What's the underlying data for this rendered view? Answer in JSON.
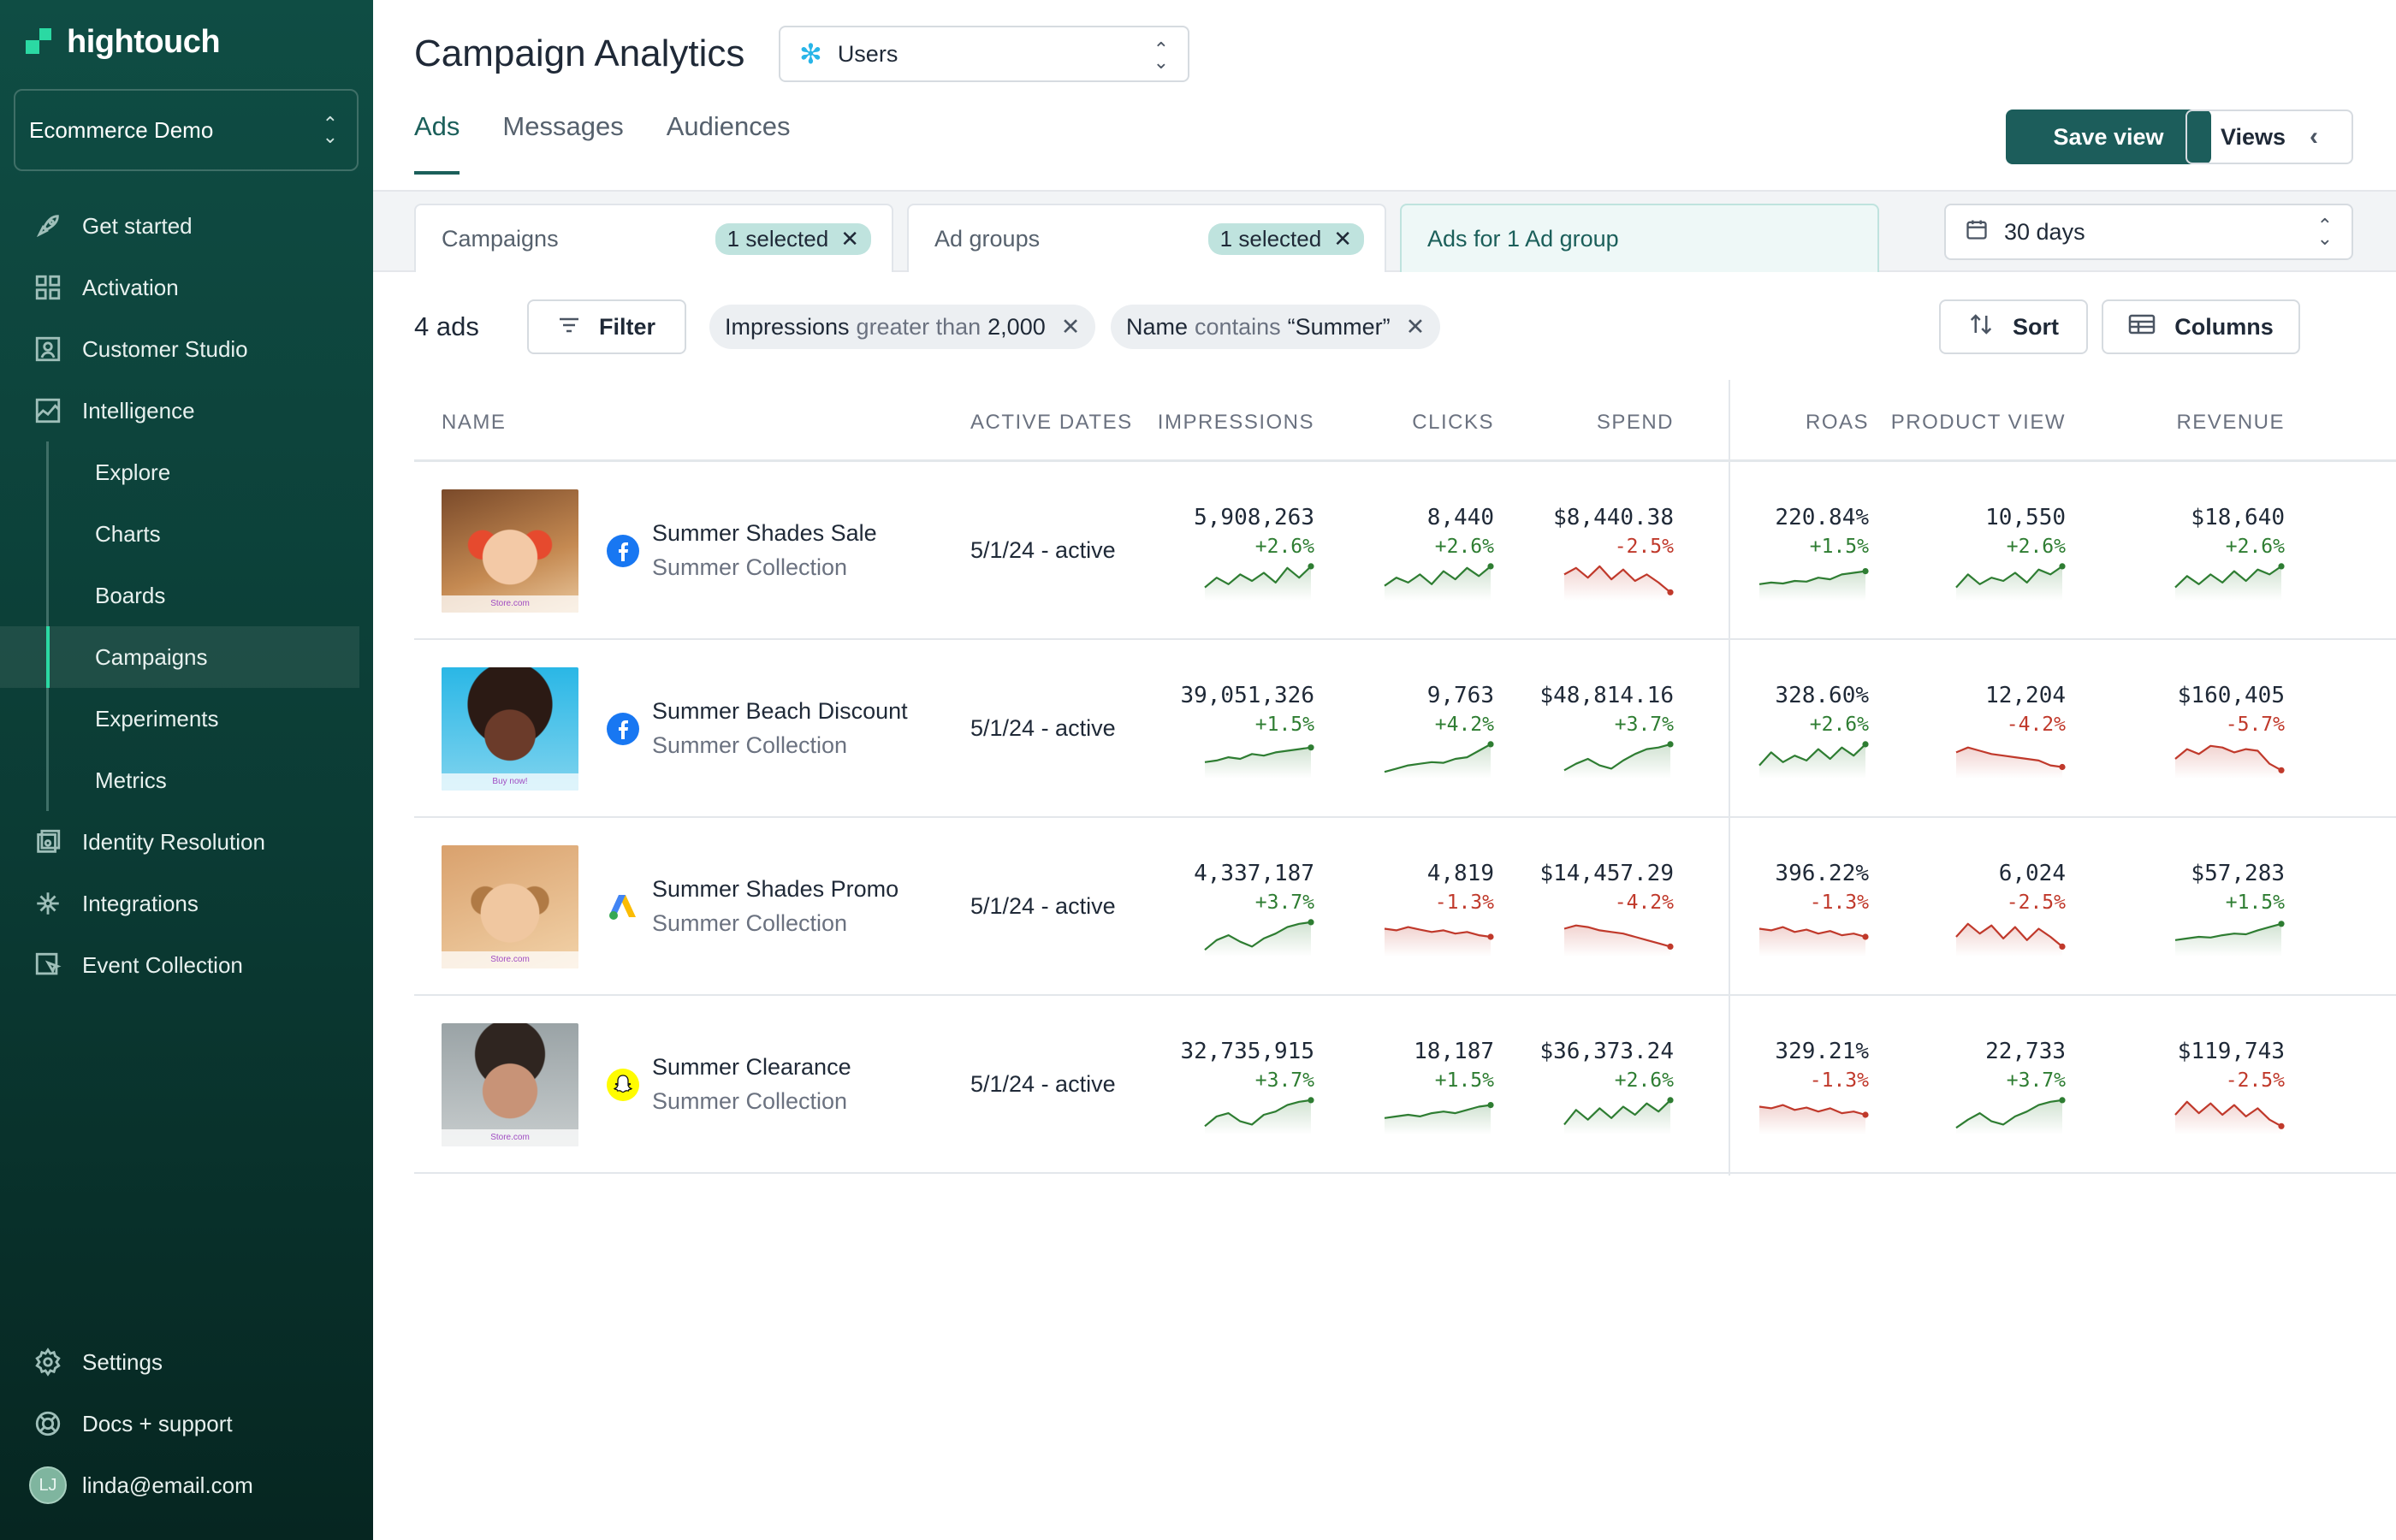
{
  "app": {
    "logo_text": "hightouch",
    "workspace": "Ecommerce Demo"
  },
  "sidebar": {
    "items": [
      {
        "label": "Get started",
        "icon": "rocket-icon"
      },
      {
        "label": "Activation",
        "icon": "grid-icon"
      },
      {
        "label": "Customer Studio",
        "icon": "person-box-icon"
      },
      {
        "label": "Intelligence",
        "icon": "chart-area-icon"
      }
    ],
    "sub_items": [
      "Explore",
      "Charts",
      "Boards",
      "Campaigns",
      "Experiments",
      "Metrics"
    ],
    "active_sub": "Campaigns",
    "items2": [
      {
        "label": "Identity Resolution",
        "icon": "identity-icon"
      },
      {
        "label": "Integrations",
        "icon": "integrations-icon"
      },
      {
        "label": "Event Collection",
        "icon": "event-icon"
      }
    ],
    "bottom": [
      {
        "label": "Settings",
        "icon": "gear-icon"
      },
      {
        "label": "Docs + support",
        "icon": "lifebuoy-icon"
      }
    ],
    "user": {
      "initials": "LJ",
      "email": "linda@email.com"
    }
  },
  "header": {
    "title": "Campaign Analytics",
    "source": "Users",
    "tabs": [
      "Ads",
      "Messages",
      "Audiences"
    ],
    "active_tab": "Ads",
    "save_view": "Save view",
    "views": "Views"
  },
  "filters": {
    "campaigns": {
      "label": "Campaigns",
      "chip": "1 selected"
    },
    "ad_groups": {
      "label": "Ad groups",
      "chip": "1 selected"
    },
    "ads": {
      "label": "Ads for 1 Ad group"
    },
    "date_range": "30 days"
  },
  "toolbar": {
    "count": "4 ads",
    "filter": "Filter",
    "pills": [
      {
        "field": "Impressions",
        "op": "greater than",
        "value": "2,000"
      },
      {
        "field": "Name",
        "op": "contains",
        "value": "“Summer”"
      }
    ],
    "sort": "Sort",
    "columns": "Columns"
  },
  "table": {
    "columns": [
      "NAME",
      "ACTIVE DATES",
      "IMPRESSIONS",
      "CLICKS",
      "SPEND",
      "ROAS",
      "PRODUCT VIEW",
      "REVENUE"
    ],
    "rows": [
      {
        "name": "Summer Shades Sale",
        "collection": "Summer Collection",
        "platform": "facebook-icon",
        "thumb_caption": "Store.com",
        "dates": "5/1/24 - active",
        "metrics": [
          {
            "value": "5,908,263",
            "delta": "+2.6%",
            "dir": "up",
            "spark": [
              0.3,
              0.6,
              0.4,
              0.7,
              0.5,
              0.75,
              0.45,
              0.9,
              0.6,
              0.95
            ]
          },
          {
            "value": "8,440",
            "delta": "+2.6%",
            "dir": "up",
            "spark": [
              0.35,
              0.6,
              0.45,
              0.7,
              0.4,
              0.8,
              0.55,
              0.9,
              0.65,
              0.95
            ]
          },
          {
            "value": "$8,440.38",
            "delta": "-2.5%",
            "dir": "down",
            "spark": [
              0.7,
              0.9,
              0.6,
              0.95,
              0.55,
              0.85,
              0.5,
              0.7,
              0.45,
              0.15
            ]
          },
          {
            "value": "220.84%",
            "delta": "+1.5%",
            "dir": "up",
            "spark": [
              0.4,
              0.45,
              0.42,
              0.5,
              0.48,
              0.6,
              0.55,
              0.7,
              0.75,
              0.8
            ]
          },
          {
            "value": "10,550",
            "delta": "+2.6%",
            "dir": "up",
            "spark": [
              0.3,
              0.7,
              0.4,
              0.6,
              0.5,
              0.75,
              0.45,
              0.85,
              0.7,
              0.95
            ]
          },
          {
            "value": "$18,640",
            "delta": "+2.6%",
            "dir": "up",
            "spark": [
              0.3,
              0.65,
              0.4,
              0.7,
              0.45,
              0.8,
              0.5,
              0.85,
              0.7,
              0.95
            ]
          }
        ]
      },
      {
        "name": "Summer Beach Discount",
        "collection": "Summer Collection",
        "platform": "facebook-icon",
        "thumb_caption": "Buy now!",
        "dates": "5/1/24 - active",
        "metrics": [
          {
            "value": "39,051,326",
            "delta": "+1.5%",
            "dir": "up",
            "spark": [
              0.4,
              0.45,
              0.55,
              0.5,
              0.65,
              0.6,
              0.7,
              0.75,
              0.8,
              0.85
            ]
          },
          {
            "value": "9,763",
            "delta": "+4.2%",
            "dir": "up",
            "spark": [
              0.1,
              0.2,
              0.3,
              0.35,
              0.4,
              0.38,
              0.5,
              0.55,
              0.75,
              0.95
            ]
          },
          {
            "value": "$48,814.16",
            "delta": "+3.7%",
            "dir": "up",
            "spark": [
              0.15,
              0.35,
              0.5,
              0.3,
              0.2,
              0.45,
              0.65,
              0.8,
              0.85,
              0.95
            ]
          },
          {
            "value": "328.60%",
            "delta": "+2.6%",
            "dir": "up",
            "spark": [
              0.3,
              0.7,
              0.4,
              0.6,
              0.45,
              0.8,
              0.5,
              0.85,
              0.6,
              0.95
            ]
          },
          {
            "value": "12,204",
            "delta": "-4.2%",
            "dir": "down",
            "spark": [
              0.7,
              0.85,
              0.75,
              0.65,
              0.6,
              0.55,
              0.5,
              0.45,
              0.3,
              0.25
            ]
          },
          {
            "value": "$160,405",
            "delta": "-5.7%",
            "dir": "down",
            "spark": [
              0.5,
              0.8,
              0.65,
              0.9,
              0.85,
              0.7,
              0.8,
              0.75,
              0.35,
              0.15
            ]
          }
        ]
      },
      {
        "name": "Summer Shades Promo",
        "collection": "Summer Collection",
        "platform": "google-ads-icon",
        "thumb_caption": "Store.com",
        "dates": "5/1/24 - active",
        "metrics": [
          {
            "value": "4,337,187",
            "delta": "+3.7%",
            "dir": "up",
            "spark": [
              0.1,
              0.4,
              0.55,
              0.35,
              0.2,
              0.45,
              0.6,
              0.8,
              0.9,
              0.95
            ]
          },
          {
            "value": "4,819",
            "delta": "-1.3%",
            "dir": "down",
            "spark": [
              0.75,
              0.7,
              0.8,
              0.72,
              0.65,
              0.7,
              0.6,
              0.65,
              0.55,
              0.5
            ]
          },
          {
            "value": "$14,457.29",
            "delta": "-4.2%",
            "dir": "down",
            "spark": [
              0.75,
              0.85,
              0.8,
              0.7,
              0.65,
              0.6,
              0.5,
              0.4,
              0.3,
              0.2
            ]
          },
          {
            "value": "396.22%",
            "delta": "-1.3%",
            "dir": "down",
            "spark": [
              0.75,
              0.7,
              0.8,
              0.65,
              0.72,
              0.6,
              0.68,
              0.55,
              0.6,
              0.5
            ]
          },
          {
            "value": "6,024",
            "delta": "-2.5%",
            "dir": "down",
            "spark": [
              0.5,
              0.9,
              0.6,
              0.85,
              0.45,
              0.8,
              0.4,
              0.75,
              0.5,
              0.2
            ]
          },
          {
            "value": "$57,283",
            "delta": "+1.5%",
            "dir": "up",
            "spark": [
              0.4,
              0.45,
              0.5,
              0.48,
              0.55,
              0.6,
              0.58,
              0.7,
              0.8,
              0.9
            ]
          }
        ]
      },
      {
        "name": "Summer Clearance",
        "collection": "Summer Collection",
        "platform": "snapchat-icon",
        "thumb_caption": "Store.com",
        "dates": "5/1/24 - active",
        "metrics": [
          {
            "value": "32,735,915",
            "delta": "+3.7%",
            "dir": "up",
            "spark": [
              0.15,
              0.45,
              0.55,
              0.3,
              0.2,
              0.5,
              0.6,
              0.8,
              0.9,
              0.95
            ]
          },
          {
            "value": "18,187",
            "delta": "+1.5%",
            "dir": "up",
            "spark": [
              0.4,
              0.45,
              0.5,
              0.45,
              0.55,
              0.6,
              0.55,
              0.65,
              0.75,
              0.8
            ]
          },
          {
            "value": "$36,373.24",
            "delta": "+2.6%",
            "dir": "up",
            "spark": [
              0.2,
              0.65,
              0.35,
              0.7,
              0.4,
              0.75,
              0.5,
              0.85,
              0.6,
              0.95
            ]
          },
          {
            "value": "329.21%",
            "delta": "-1.3%",
            "dir": "down",
            "spark": [
              0.75,
              0.7,
              0.8,
              0.65,
              0.72,
              0.6,
              0.7,
              0.55,
              0.6,
              0.5
            ]
          },
          {
            "value": "22,733",
            "delta": "+3.7%",
            "dir": "up",
            "spark": [
              0.1,
              0.35,
              0.55,
              0.3,
              0.2,
              0.45,
              0.6,
              0.8,
              0.9,
              0.95
            ]
          },
          {
            "value": "$119,743",
            "delta": "-2.5%",
            "dir": "down",
            "spark": [
              0.5,
              0.9,
              0.55,
              0.85,
              0.5,
              0.8,
              0.45,
              0.7,
              0.35,
              0.15
            ]
          }
        ]
      }
    ]
  },
  "colors": {
    "accent": "#1c5d5b",
    "up": "#2e7d32",
    "down": "#c0392b",
    "brand": "#2bd9a3"
  }
}
